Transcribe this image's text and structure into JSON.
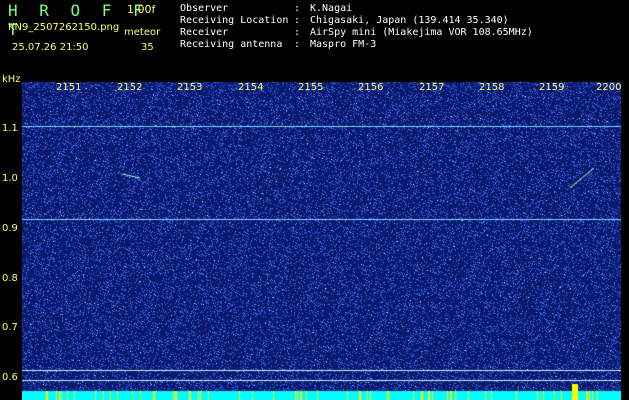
{
  "header": {
    "title": "H R O F F T",
    "version": "1.00f",
    "filename": "KN9_2507262150.png",
    "meteor_label": "meteor",
    "datetime": "25.07.26 21:50",
    "meteor_count": "35",
    "info": [
      {
        "key": "Observer",
        "value": "K.Nagai"
      },
      {
        "key": "Receiving Location",
        "value": "Chigasaki, Japan (139.414 35.340)"
      },
      {
        "key": "Receiver",
        "value": "AirSpy mini (Miakejima VOR 108.65MHz)"
      },
      {
        "key": "Receiving antenna",
        "value": "Maspro FM-3"
      }
    ]
  },
  "plot": {
    "unit": "kHz",
    "time_ticks": [
      "2151",
      "2152",
      "2153",
      "2154",
      "2155",
      "2156",
      "2157",
      "2158",
      "2159",
      "2200"
    ],
    "freq_ticks": [
      "1.1",
      "1.0",
      "0.9",
      "0.8",
      "0.7",
      "0.6"
    ],
    "colors": {
      "background": "#0a1a6e",
      "noise": "#3a6dff",
      "bright": "#9fffd0",
      "bottom": "#00ffff",
      "markers": "#ffff00"
    }
  }
}
